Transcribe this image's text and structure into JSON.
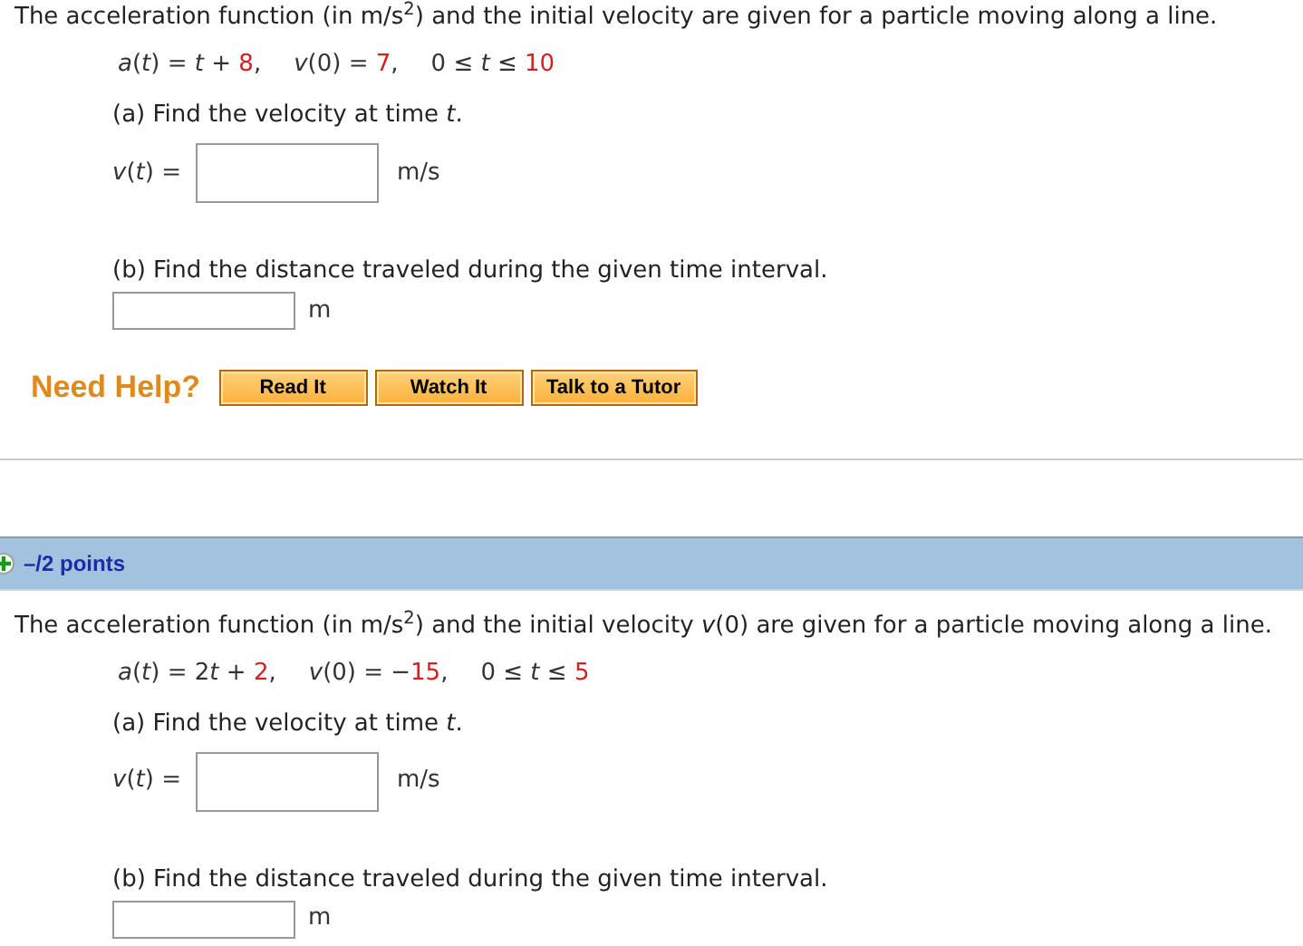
{
  "problems": [
    {
      "statement": "The acceleration function (in m/s$^{2}$) and the initial velocity are given for a particle moving along a line.",
      "formula": [
        [
          {
            "text": "*a*(*t*) = *t* + ",
            "kind": "plain"
          },
          {
            "text": "8",
            "kind": "value"
          },
          {
            "text": ",",
            "kind": "plain"
          }
        ],
        [
          {
            "text": "*v*(0) = ",
            "kind": "plain"
          },
          {
            "text": "7",
            "kind": "value"
          },
          {
            "text": ",",
            "kind": "plain"
          }
        ],
        [
          {
            "text": "0 ≤ *t* ≤ ",
            "kind": "plain"
          },
          {
            "text": "10",
            "kind": "value"
          }
        ]
      ],
      "part_a": {
        "question": "(a) Find the velocity at time *t*.",
        "label": "*v*(*t*) =",
        "unit": "m/s"
      },
      "part_b": {
        "question": "(b) Find the distance traveled during the given time interval.",
        "unit": "m"
      },
      "help": {
        "title": "Need Help?",
        "buttons": [
          "Read It",
          "Watch It",
          "Talk to a Tutor"
        ]
      }
    },
    {
      "points": "–/2 points",
      "statement": "The acceleration function (in m/s$^{2}$) and the initial velocity *v*(0) are given for a particle moving along a line.",
      "formula": [
        [
          {
            "text": "*a*(*t*) = 2",
            "kind": "plain"
          },
          {
            "text": "*t*",
            "kind": "plain"
          },
          {
            "text": " + ",
            "kind": "plain"
          },
          {
            "text": "2",
            "kind": "value"
          },
          {
            "text": ",",
            "kind": "plain"
          }
        ],
        [
          {
            "text": "*v*(0) = −",
            "kind": "plain"
          },
          {
            "text": "15",
            "kind": "value"
          },
          {
            "text": ",",
            "kind": "plain"
          }
        ],
        [
          {
            "text": "0 ≤ *t* ≤ ",
            "kind": "plain"
          },
          {
            "text": "5",
            "kind": "value"
          }
        ]
      ],
      "part_a": {
        "question": "(a) Find the velocity at time *t*.",
        "label": "*v*(*t*) =",
        "unit": "m/s"
      },
      "part_b": {
        "question": "(b) Find the distance traveled during the given time interval.",
        "unit": "m"
      }
    }
  ]
}
